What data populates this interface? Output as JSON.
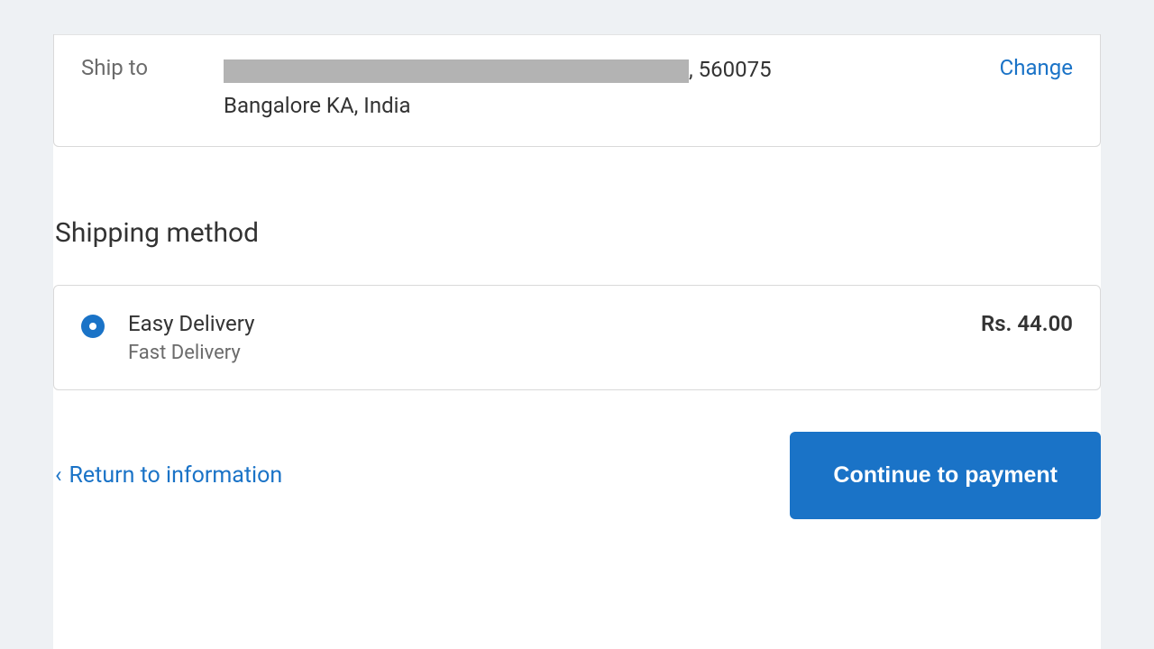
{
  "ship_to": {
    "label": "Ship to",
    "postal": ", 560075",
    "line2": "Bangalore KA, India",
    "change": "Change"
  },
  "shipping_method": {
    "title": "Shipping method",
    "option": {
      "name": "Easy Delivery",
      "sub": "Fast Delivery",
      "price": "Rs. 44.00"
    }
  },
  "footer": {
    "return": "Return to information",
    "continue": "Continue to payment"
  }
}
